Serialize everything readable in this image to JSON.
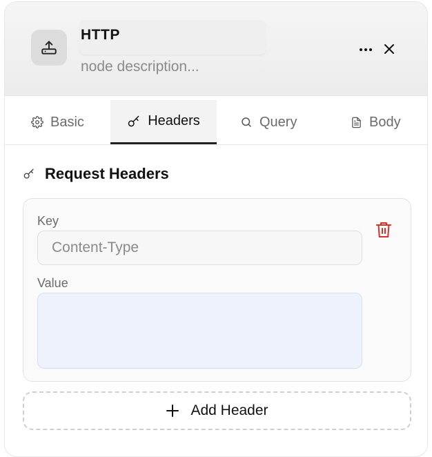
{
  "node": {
    "icon": "upload-icon",
    "title": "HTTP",
    "description_placeholder": "node description..."
  },
  "header_actions": {
    "more_icon": "more-horizontal-icon",
    "close_icon": "close-icon"
  },
  "tabs": [
    {
      "label": "Basic",
      "icon": "gear-icon",
      "active": false
    },
    {
      "label": "Headers",
      "icon": "key-icon",
      "active": true
    },
    {
      "label": "Query",
      "icon": "search-icon",
      "active": false
    },
    {
      "label": "Body",
      "icon": "document-icon",
      "active": false
    }
  ],
  "section": {
    "title": "Request Headers",
    "icon": "key-icon"
  },
  "header_row": {
    "key_label": "Key",
    "key_value": "Content-Type",
    "value_label": "Value",
    "value_value": "",
    "delete_icon": "trash-icon"
  },
  "add_button": {
    "label": "Add Header",
    "icon": "plus-icon"
  },
  "colors": {
    "delete": "#d93025",
    "active_tab_underline": "#222222",
    "value_field_bg": "#eef2fd"
  }
}
